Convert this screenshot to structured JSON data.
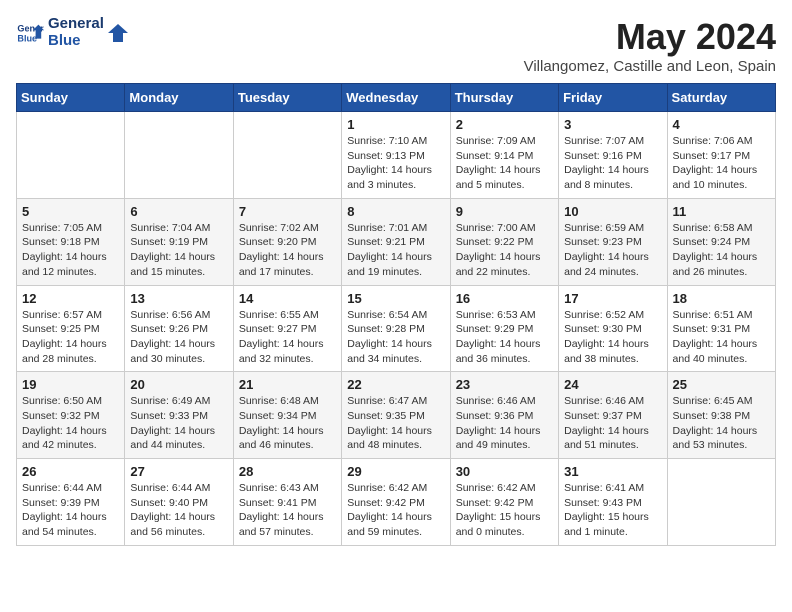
{
  "header": {
    "logo_line1": "General",
    "logo_line2": "Blue",
    "month_title": "May 2024",
    "subtitle": "Villangomez, Castille and Leon, Spain"
  },
  "weekdays": [
    "Sunday",
    "Monday",
    "Tuesday",
    "Wednesday",
    "Thursday",
    "Friday",
    "Saturday"
  ],
  "weeks": [
    [
      {
        "day": "",
        "info": ""
      },
      {
        "day": "",
        "info": ""
      },
      {
        "day": "",
        "info": ""
      },
      {
        "day": "1",
        "info": "Sunrise: 7:10 AM\nSunset: 9:13 PM\nDaylight: 14 hours and 3 minutes."
      },
      {
        "day": "2",
        "info": "Sunrise: 7:09 AM\nSunset: 9:14 PM\nDaylight: 14 hours and 5 minutes."
      },
      {
        "day": "3",
        "info": "Sunrise: 7:07 AM\nSunset: 9:16 PM\nDaylight: 14 hours and 8 minutes."
      },
      {
        "day": "4",
        "info": "Sunrise: 7:06 AM\nSunset: 9:17 PM\nDaylight: 14 hours and 10 minutes."
      }
    ],
    [
      {
        "day": "5",
        "info": "Sunrise: 7:05 AM\nSunset: 9:18 PM\nDaylight: 14 hours and 12 minutes."
      },
      {
        "day": "6",
        "info": "Sunrise: 7:04 AM\nSunset: 9:19 PM\nDaylight: 14 hours and 15 minutes."
      },
      {
        "day": "7",
        "info": "Sunrise: 7:02 AM\nSunset: 9:20 PM\nDaylight: 14 hours and 17 minutes."
      },
      {
        "day": "8",
        "info": "Sunrise: 7:01 AM\nSunset: 9:21 PM\nDaylight: 14 hours and 19 minutes."
      },
      {
        "day": "9",
        "info": "Sunrise: 7:00 AM\nSunset: 9:22 PM\nDaylight: 14 hours and 22 minutes."
      },
      {
        "day": "10",
        "info": "Sunrise: 6:59 AM\nSunset: 9:23 PM\nDaylight: 14 hours and 24 minutes."
      },
      {
        "day": "11",
        "info": "Sunrise: 6:58 AM\nSunset: 9:24 PM\nDaylight: 14 hours and 26 minutes."
      }
    ],
    [
      {
        "day": "12",
        "info": "Sunrise: 6:57 AM\nSunset: 9:25 PM\nDaylight: 14 hours and 28 minutes."
      },
      {
        "day": "13",
        "info": "Sunrise: 6:56 AM\nSunset: 9:26 PM\nDaylight: 14 hours and 30 minutes."
      },
      {
        "day": "14",
        "info": "Sunrise: 6:55 AM\nSunset: 9:27 PM\nDaylight: 14 hours and 32 minutes."
      },
      {
        "day": "15",
        "info": "Sunrise: 6:54 AM\nSunset: 9:28 PM\nDaylight: 14 hours and 34 minutes."
      },
      {
        "day": "16",
        "info": "Sunrise: 6:53 AM\nSunset: 9:29 PM\nDaylight: 14 hours and 36 minutes."
      },
      {
        "day": "17",
        "info": "Sunrise: 6:52 AM\nSunset: 9:30 PM\nDaylight: 14 hours and 38 minutes."
      },
      {
        "day": "18",
        "info": "Sunrise: 6:51 AM\nSunset: 9:31 PM\nDaylight: 14 hours and 40 minutes."
      }
    ],
    [
      {
        "day": "19",
        "info": "Sunrise: 6:50 AM\nSunset: 9:32 PM\nDaylight: 14 hours and 42 minutes."
      },
      {
        "day": "20",
        "info": "Sunrise: 6:49 AM\nSunset: 9:33 PM\nDaylight: 14 hours and 44 minutes."
      },
      {
        "day": "21",
        "info": "Sunrise: 6:48 AM\nSunset: 9:34 PM\nDaylight: 14 hours and 46 minutes."
      },
      {
        "day": "22",
        "info": "Sunrise: 6:47 AM\nSunset: 9:35 PM\nDaylight: 14 hours and 48 minutes."
      },
      {
        "day": "23",
        "info": "Sunrise: 6:46 AM\nSunset: 9:36 PM\nDaylight: 14 hours and 49 minutes."
      },
      {
        "day": "24",
        "info": "Sunrise: 6:46 AM\nSunset: 9:37 PM\nDaylight: 14 hours and 51 minutes."
      },
      {
        "day": "25",
        "info": "Sunrise: 6:45 AM\nSunset: 9:38 PM\nDaylight: 14 hours and 53 minutes."
      }
    ],
    [
      {
        "day": "26",
        "info": "Sunrise: 6:44 AM\nSunset: 9:39 PM\nDaylight: 14 hours and 54 minutes."
      },
      {
        "day": "27",
        "info": "Sunrise: 6:44 AM\nSunset: 9:40 PM\nDaylight: 14 hours and 56 minutes."
      },
      {
        "day": "28",
        "info": "Sunrise: 6:43 AM\nSunset: 9:41 PM\nDaylight: 14 hours and 57 minutes."
      },
      {
        "day": "29",
        "info": "Sunrise: 6:42 AM\nSunset: 9:42 PM\nDaylight: 14 hours and 59 minutes."
      },
      {
        "day": "30",
        "info": "Sunrise: 6:42 AM\nSunset: 9:42 PM\nDaylight: 15 hours and 0 minutes."
      },
      {
        "day": "31",
        "info": "Sunrise: 6:41 AM\nSunset: 9:43 PM\nDaylight: 15 hours and 1 minute."
      },
      {
        "day": "",
        "info": ""
      }
    ]
  ]
}
